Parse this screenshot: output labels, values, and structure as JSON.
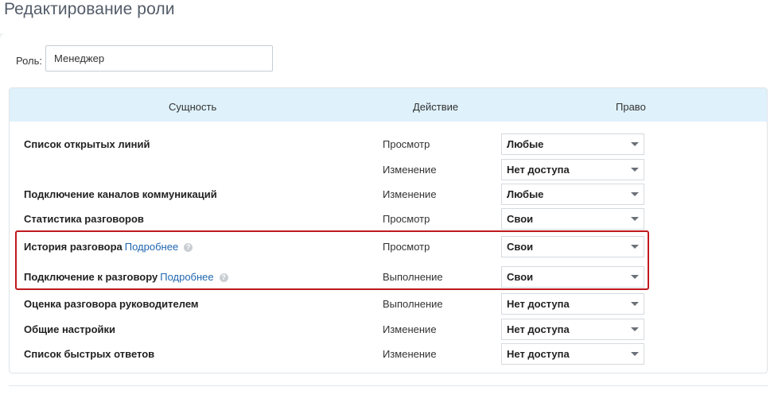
{
  "page": {
    "title": "Редактирование роли"
  },
  "role": {
    "label": "Роль:",
    "value": "Менеджер"
  },
  "table": {
    "headers": {
      "entity": "Сущность",
      "action": "Действие",
      "right": "Право"
    },
    "rows": [
      {
        "entity": "Список открытых линий",
        "action": "Просмотр",
        "right": "Любые"
      },
      {
        "entity": "",
        "action": "Изменение",
        "right": "Нет доступа"
      },
      {
        "entity": "Подключение каналов коммуникаций",
        "action": "Изменение",
        "right": "Любые"
      },
      {
        "entity": "Статистика разговоров",
        "action": "Просмотр",
        "right": "Свои"
      },
      {
        "entity": "История разговора",
        "more": "Подробнее",
        "action": "Просмотр",
        "right": "Свои"
      },
      {
        "entity": "Подключение к разговору",
        "more": "Подробнее",
        "action": "Выполнение",
        "right": "Свои"
      },
      {
        "entity": "Оценка разговора руководителем",
        "action": "Выполнение",
        "right": "Нет доступа"
      },
      {
        "entity": "Общие настройки",
        "action": "Изменение",
        "right": "Нет доступа"
      },
      {
        "entity": "Список быстрых ответов",
        "action": "Изменение",
        "right": "Нет доступа"
      }
    ]
  },
  "colors": {
    "header_bg": "#dff1fb",
    "highlight": "#c0191d",
    "link": "#2067b0"
  },
  "icons": {
    "help": "question-circle-icon",
    "dropdown": "chevron-down-icon"
  }
}
